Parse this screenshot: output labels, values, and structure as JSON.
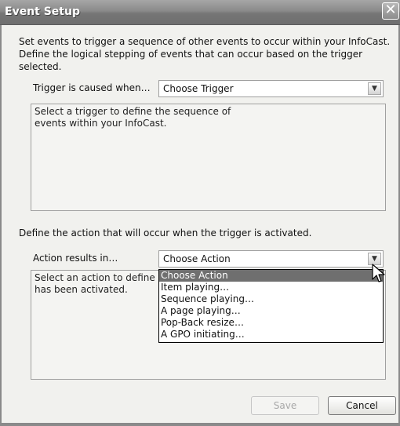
{
  "window": {
    "title": "Event Setup",
    "close_glyph": "✕"
  },
  "description": {
    "line1": "Set events to trigger a sequence of other events to occur within your InfoCast.",
    "line2": "Define the logical stepping of events that can occur based on the trigger selected."
  },
  "trigger": {
    "label": "Trigger is caused when…",
    "selected": "Choose Trigger",
    "info_line1": "Select a trigger to define the sequence of",
    "info_line2": "events within your InfoCast."
  },
  "action_section": {
    "heading": "Define the action that will occur when the trigger is activated."
  },
  "action": {
    "label": "Action results in…",
    "selected": "Choose Action",
    "info_line1": "Select an action to define wh",
    "info_line2": "has been activated.",
    "options": [
      "Choose Action",
      "Item playing…",
      "Sequence playing…",
      "A page playing…",
      "Pop-Back resize…",
      "A GPO initiating…"
    ]
  },
  "buttons": {
    "save": "Save",
    "cancel": "Cancel"
  },
  "icons": {
    "close": "close-icon",
    "dropdown_arrow": "chevron-down-icon",
    "cursor": "mouse-pointer-icon"
  }
}
